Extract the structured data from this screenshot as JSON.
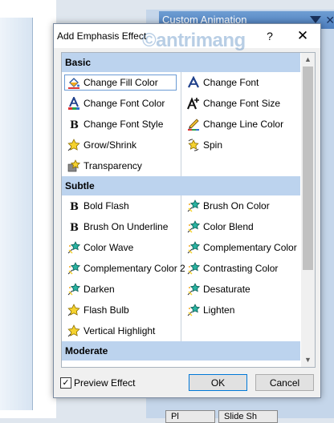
{
  "background": {
    "pane_title": "Custom Animation",
    "bottom_buttons": [
      "Pl",
      "Slide Sh"
    ]
  },
  "dialog": {
    "title": "Add Emphasis Effect",
    "help": "?",
    "close": "✕",
    "watermark": "©antrimang",
    "categories": [
      {
        "name": "Basic",
        "items": [
          {
            "label": "Change Fill Color",
            "icon": "paint-bucket-icon",
            "selected": true
          },
          {
            "label": "Change Font",
            "icon": "font-a-icon"
          },
          {
            "label": "Change Font Color",
            "icon": "font-color-icon"
          },
          {
            "label": "Change Font Size",
            "icon": "font-size-icon"
          },
          {
            "label": "Change Font Style",
            "icon": "bold-b-icon"
          },
          {
            "label": "Change Line Color",
            "icon": "pencil-line-icon"
          },
          {
            "label": "Grow/Shrink",
            "icon": "star-icon"
          },
          {
            "label": "Spin",
            "icon": "spin-star-icon"
          },
          {
            "label": "Transparency",
            "icon": "transparency-star-icon"
          }
        ]
      },
      {
        "name": "Subtle",
        "items": [
          {
            "label": "Bold Flash",
            "icon": "bold-b-icon"
          },
          {
            "label": "Brush On Color",
            "icon": "sparkle-star-icon"
          },
          {
            "label": "Brush On Underline",
            "icon": "bold-b-icon"
          },
          {
            "label": "Color Blend",
            "icon": "sparkle-star-icon"
          },
          {
            "label": "Color Wave",
            "icon": "sparkle-star-icon"
          },
          {
            "label": "Complementary Color",
            "icon": "sparkle-star-icon"
          },
          {
            "label": "Complementary Color 2",
            "icon": "sparkle-star-icon"
          },
          {
            "label": "Contrasting Color",
            "icon": "sparkle-star-icon"
          },
          {
            "label": "Darken",
            "icon": "sparkle-star-icon"
          },
          {
            "label": "Desaturate",
            "icon": "sparkle-star-icon"
          },
          {
            "label": "Flash Bulb",
            "icon": "star-icon"
          },
          {
            "label": "Lighten",
            "icon": "sparkle-star-icon"
          },
          {
            "label": "Vertical Highlight",
            "icon": "star-icon"
          }
        ]
      },
      {
        "name": "Moderate",
        "items": []
      }
    ],
    "preview_checkbox": {
      "label": "Preview Effect",
      "checked": true,
      "check_mark": "✓"
    },
    "ok_label": "OK",
    "cancel_label": "Cancel",
    "colors": {
      "category_header": "#bcd3ee",
      "selection_border": "#6b9bd4",
      "star_yellow": "#f5d22e"
    }
  }
}
